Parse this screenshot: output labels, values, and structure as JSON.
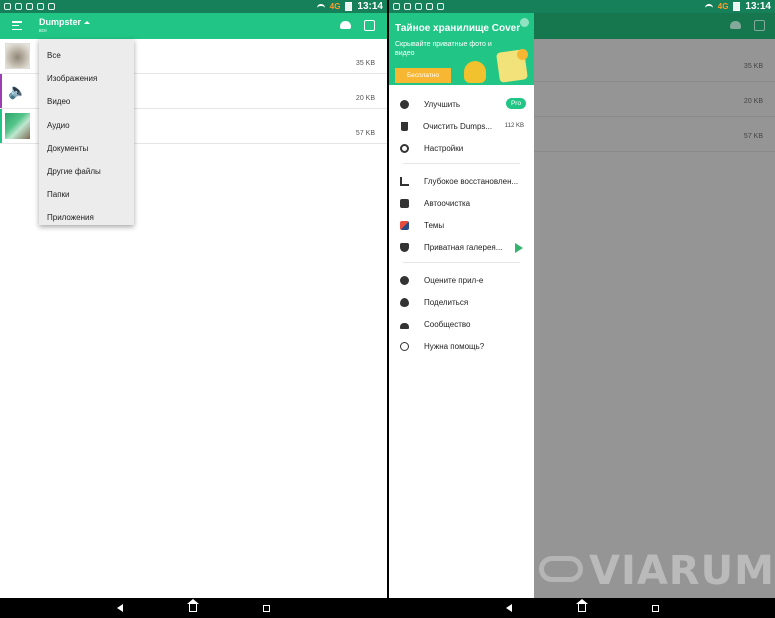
{
  "status": {
    "network": "4G",
    "time": "13:14"
  },
  "left": {
    "app_title": "Dumpster",
    "app_subtitle": "все",
    "files": [
      {
        "size": "35 KB",
        "type": "image"
      },
      {
        "size": "20 KB",
        "type": "audio"
      },
      {
        "size": "57 KB",
        "type": "image"
      }
    ],
    "filter_menu": [
      "Все",
      "Изображения",
      "Видео",
      "Аудио",
      "Документы",
      "Другие файлы",
      "Папки",
      "Приложения"
    ]
  },
  "right": {
    "dim_sizes": [
      "35 KB",
      "20 KB",
      "57 KB"
    ],
    "promo": {
      "title": "Тайное хранилище Cover",
      "subtitle": "Скрывайте приватные фото и видео",
      "button": "Бесплатно"
    },
    "menu_group1": [
      {
        "label": "Улучшить",
        "badge": "Pro",
        "icon": "upgrade-icon"
      },
      {
        "label": "Очистить Dumps...",
        "extra": "112 KB",
        "icon": "trash-icon"
      },
      {
        "label": "Настройки",
        "icon": "gear-icon"
      }
    ],
    "menu_group2": [
      {
        "label": "Глубокое восстановлен...",
        "icon": "deep-recovery-icon"
      },
      {
        "label": "Автоочистка",
        "icon": "robot-icon"
      },
      {
        "label": "Темы",
        "icon": "themes-icon"
      },
      {
        "label": "Приватная галерея...",
        "icon": "shield-icon"
      }
    ],
    "menu_group3": [
      {
        "label": "Оцените прил-е",
        "icon": "star-icon"
      },
      {
        "label": "Поделиться",
        "icon": "heart-icon"
      },
      {
        "label": "Сообщество",
        "icon": "people-icon"
      },
      {
        "label": "Нужна помощь?",
        "icon": "globe-icon"
      }
    ]
  },
  "watermark": "VIARUM",
  "colors": {
    "accent": "#21c586",
    "status_bar": "#16805a",
    "promo_button": "#f7b733"
  }
}
